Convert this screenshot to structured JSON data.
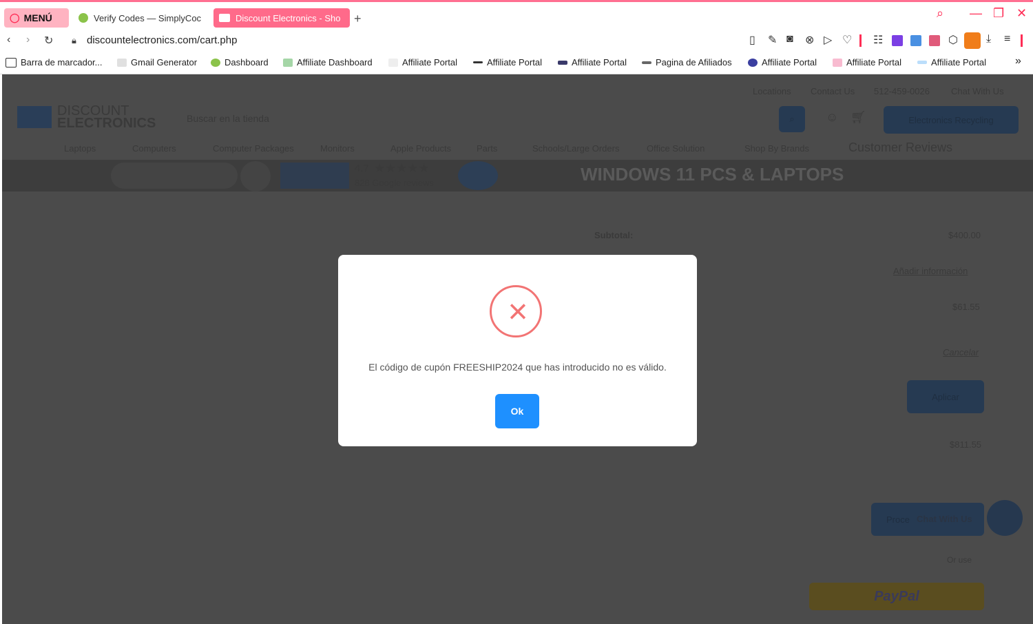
{
  "browser": {
    "tabs": {
      "menu": "MENÚ",
      "verify": "Verify Codes — SimplyCoc",
      "active": "Discount Electronics - Sho"
    },
    "new_tab": "+",
    "url": "discountelectronics.com/cart.php",
    "bookmarks": [
      "Barra de marcador...",
      "Gmail Generator",
      "Dashboard",
      "Affiliate Dashboard",
      "Affiliate Portal",
      "Affiliate Portal",
      "Affiliate Portal",
      "Pagina de Afiliados",
      "Affiliate Portal",
      "Affiliate Portal",
      "Affiliate Portal"
    ],
    "bookmarks_more": "»"
  },
  "site": {
    "top_links": [
      "Locations",
      "Contact Us",
      "512-459-0026",
      "Chat With Us"
    ],
    "logo_line1": "DISCOUNT",
    "logo_line2": "ELECTRONICS",
    "search_placeholder": "Buscar en la tienda",
    "recycling_button": "Electronics Recycling",
    "nav": [
      "Laptops",
      "Computers",
      "Computer Packages",
      "Monitors",
      "Apple Products",
      "Parts",
      "Schools/Large Orders",
      "Office Solution",
      "Shop By Brands",
      "Customer Reviews"
    ],
    "rating": "4.7",
    "reviews": "828 Google reviews",
    "banner_title": "WINDOWS 11 PCS & LAPTOPS",
    "subtotal_label": "Subtotal:",
    "subtotal_value": "$400.00",
    "add_info": "Añadir información",
    "tax_value": "$61.55",
    "cancel": "Cancelar",
    "apply": "Aplicar",
    "total_value": "$811.55",
    "chat_with_us": "Chat With Us",
    "proceed": "Proce",
    "or_use": "Or use",
    "paypal": "PayPal"
  },
  "modal": {
    "message": "El código de cupón FREESHIP2024 que has introducido no es válido.",
    "ok": "Ok",
    "error_icon": "×"
  }
}
